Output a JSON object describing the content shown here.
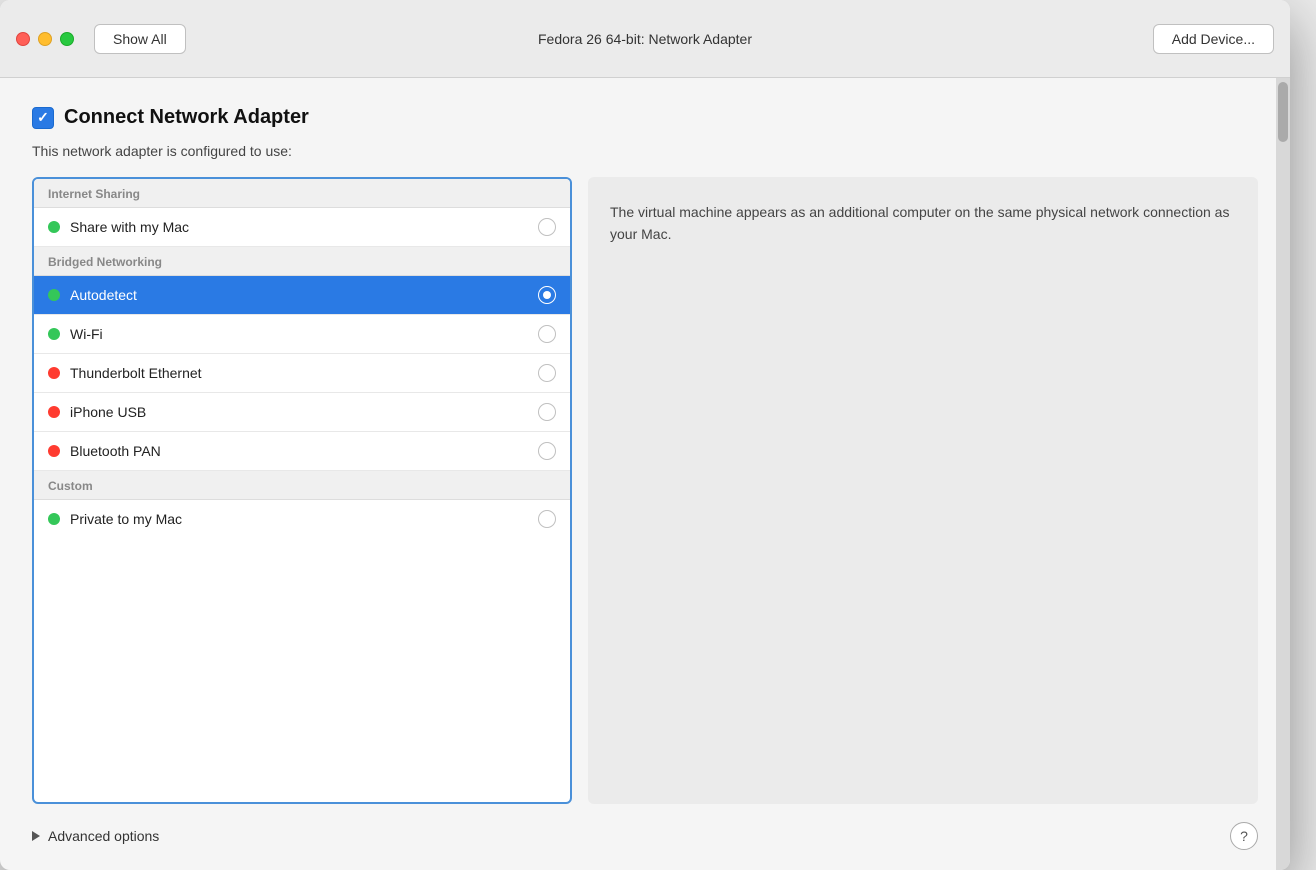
{
  "titlebar": {
    "show_all_label": "Show All",
    "title": "Fedora 26 64-bit: Network Adapter",
    "add_device_label": "Add Device..."
  },
  "content": {
    "checkbox_checked": true,
    "adapter_title": "Connect Network Adapter",
    "adapter_subtitle": "This network adapter is configured to use:",
    "sections": [
      {
        "id": "internet_sharing",
        "header": "Internet Sharing",
        "items": [
          {
            "id": "share_mac",
            "label": "Share with my Mac",
            "dot_color": "green",
            "selected": false
          }
        ]
      },
      {
        "id": "bridged_networking",
        "header": "Bridged Networking",
        "items": [
          {
            "id": "autodetect",
            "label": "Autodetect",
            "dot_color": "green",
            "selected": true
          },
          {
            "id": "wifi",
            "label": "Wi-Fi",
            "dot_color": "green",
            "selected": false
          },
          {
            "id": "thunderbolt",
            "label": "Thunderbolt Ethernet",
            "dot_color": "red",
            "selected": false
          },
          {
            "id": "iphone_usb",
            "label": "iPhone USB",
            "dot_color": "red",
            "selected": false
          },
          {
            "id": "bluetooth_pan",
            "label": "Bluetooth PAN",
            "dot_color": "red",
            "selected": false
          }
        ]
      },
      {
        "id": "custom",
        "header": "Custom",
        "items": [
          {
            "id": "private_mac",
            "label": "Private to my Mac",
            "dot_color": "green",
            "selected": false
          }
        ]
      }
    ],
    "description": "The virtual machine appears as an additional computer on the same physical network connection as your Mac.",
    "advanced_options_label": "Advanced options"
  }
}
